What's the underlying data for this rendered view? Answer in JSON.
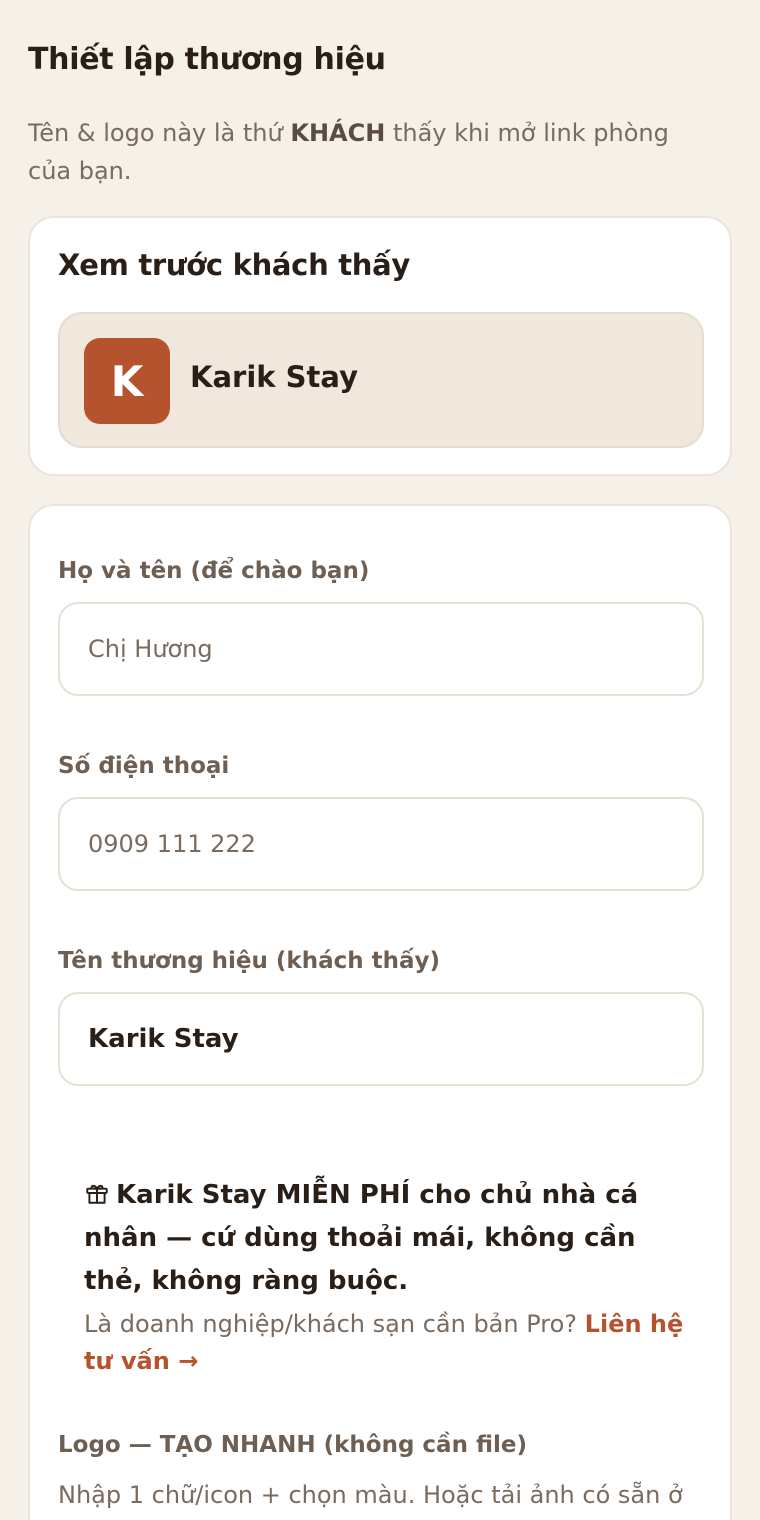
{
  "header": {
    "title": "Thiết lập thương hiệu",
    "intro_before": "Tên & logo này là thứ ",
    "intro_bold": "KHÁCH",
    "intro_after": " thấy khi mở link phòng của bạn."
  },
  "preview": {
    "title": "Xem trước khách thấy",
    "logo_letter": "K",
    "brand_name": "Karik Stay",
    "logo_color": "#b5532f"
  },
  "form": {
    "fullname": {
      "label": "Họ và tên (để chào bạn)",
      "value": "Chị Hương"
    },
    "phone": {
      "label": "Số điện thoại",
      "value": "0909 111 222"
    },
    "brand": {
      "label": "Tên thương hiệu (khách thấy)",
      "value": "Karik Stay"
    }
  },
  "promo": {
    "icon": "gift-icon",
    "text": "Karik Stay MIỄN PHÍ cho chủ nhà cá nhân — cứ dùng thoải mái, không cần thẻ, không ràng buộc.",
    "sub_text": "Là doanh nghiệp/khách sạn cần bản Pro? ",
    "link_label": "Liên hệ tư vấn →"
  },
  "logo_section": {
    "label": "Logo — TẠO NHANH (không cần file)",
    "help": "Nhập 1 chữ/icon + chọn màu. Hoặc tải ảnh có sẵn ở"
  }
}
